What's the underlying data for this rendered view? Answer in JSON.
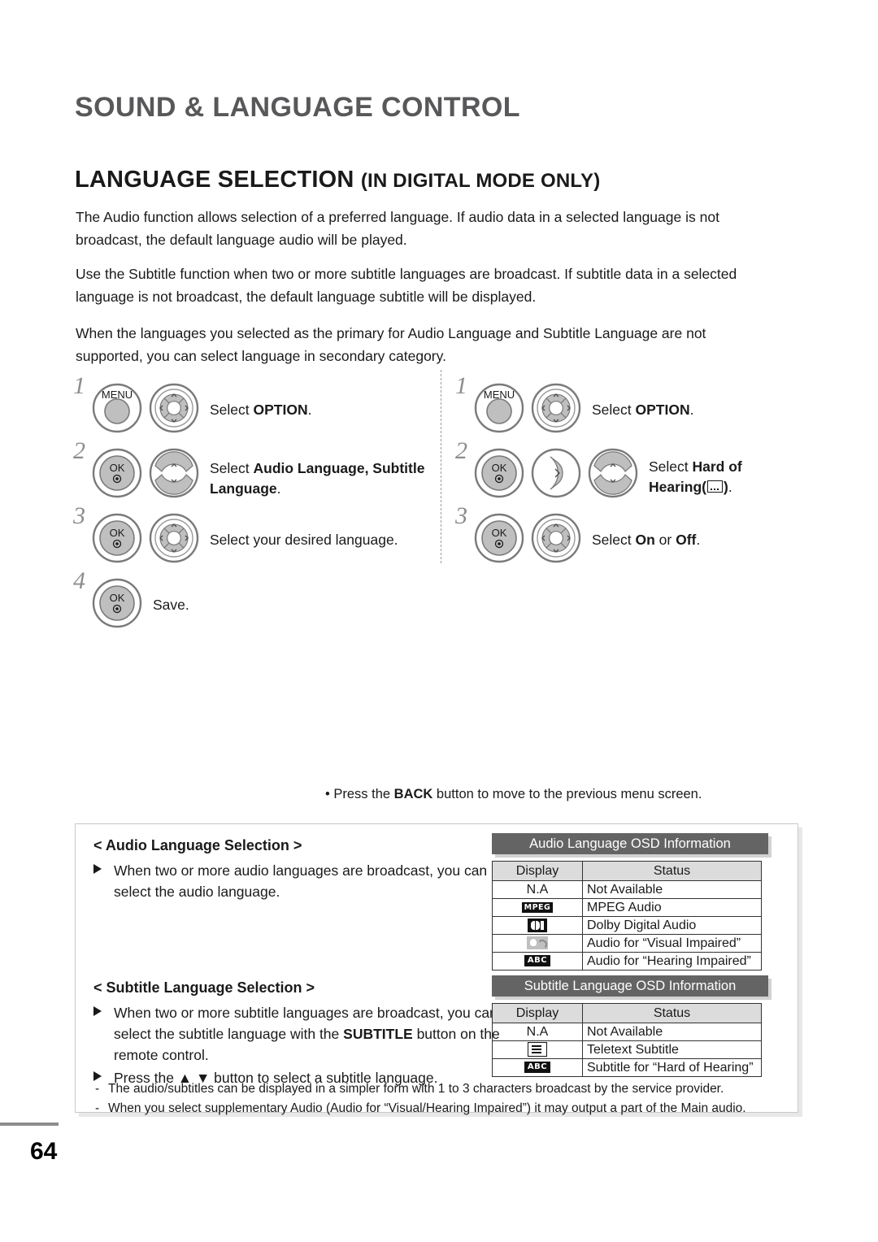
{
  "header": {
    "chapter_title": "SOUND & LANGUAGE CONTROL",
    "section_title": "LANGUAGE SELECTION",
    "section_subtitle": "(IN DIGITAL MODE ONLY)"
  },
  "intro": {
    "p1": "The Audio function allows selection of a preferred language. If audio data in a selected language is not broadcast, the default language audio will be played.",
    "p2": "Use the Subtitle function when two or more subtitle languages are broadcast. If subtitle data in a selected language is not broadcast, the default language subtitle will be displayed.",
    "p3": "When the languages you selected as the primary for Audio Language and Subtitle Language are not supported, you can select language in secondary category."
  },
  "steps_left": [
    {
      "number": "1",
      "buttons": [
        "MENU",
        "NAV4"
      ],
      "text_pre": "Select ",
      "text_bold": "OPTION",
      "text_post": "."
    },
    {
      "number": "2",
      "buttons": [
        "OK",
        "NAVUD"
      ],
      "text_pre": "Select ",
      "text_bold": "Audio Language, Subtitle Language",
      "text_post": "."
    },
    {
      "number": "3",
      "buttons": [
        "OK",
        "NAV4"
      ],
      "text_pre": "Select your desired language.",
      "text_bold": "",
      "text_post": ""
    },
    {
      "number": "4",
      "buttons": [
        "OK"
      ],
      "text_pre": "Save.",
      "text_bold": "",
      "text_post": ""
    }
  ],
  "steps_right": [
    {
      "number": "1",
      "buttons": [
        "MENU",
        "NAV4"
      ],
      "text_pre": "Select ",
      "text_bold": "OPTION",
      "text_post": "."
    },
    {
      "number": "2",
      "buttons": [
        "OK",
        "NAVR",
        "NAVUD"
      ],
      "text_pre": "Select ",
      "text_bold": "Hard of Hearing",
      "text_post": ""
    },
    {
      "number": "3",
      "buttons": [
        "OK",
        "NAV4"
      ],
      "text_pre": "Select ",
      "text_bold": "On",
      "text_mid": " or ",
      "text_bold2": "Off",
      "text_post": "."
    }
  ],
  "button_labels": {
    "menu": "MENU",
    "ok": "OK"
  },
  "tip": {
    "bullet": "•",
    "pre": "Press the ",
    "bold": "BACK",
    "post": " button to move to the previous menu screen."
  },
  "audio_section": {
    "heading": "< Audio Language Selection >",
    "bullet1": "When two or more audio languages are broadcast, you can select the audio language."
  },
  "subtitle_section": {
    "heading": "< Subtitle Language Selection >",
    "bullet1_pre": "When two or more subtitle languages are broadcast, you can select the subtitle language with the ",
    "bullet1_bold": "SUBTITLE",
    "bullet1_post": " button on the remote control.",
    "bullet2": "Press the ▲ ▼ button to select a subtitle language."
  },
  "notes": [
    "The audio/subtitles can be displayed in a simpler form with 1 to 3 characters broadcast by the service provider.",
    "When you select supplementary Audio (Audio for “Visual/Hearing Impaired”) it may output a part of the Main audio."
  ],
  "osd_audio": {
    "title": "Audio Language OSD Information",
    "columns": [
      "Display",
      "Status"
    ],
    "rows": [
      {
        "display_text": "N.A",
        "display_icon": "",
        "status": "Not Available"
      },
      {
        "display_text": "",
        "display_icon": "mpeg-icon",
        "status": "MPEG Audio"
      },
      {
        "display_text": "",
        "display_icon": "dolby-icon",
        "status": "Dolby Digital Audio"
      },
      {
        "display_text": "",
        "display_icon": "visual-impaired-icon",
        "status": "Audio for “Visual Impaired”"
      },
      {
        "display_text": "",
        "display_icon": "abc-icon",
        "status": "Audio for “Hearing Impaired”"
      }
    ]
  },
  "osd_subtitle": {
    "title": "Subtitle Language OSD Information",
    "columns": [
      "Display",
      "Status"
    ],
    "rows": [
      {
        "display_text": "N.A",
        "display_icon": "",
        "status": "Not Available"
      },
      {
        "display_text": "",
        "display_icon": "teletext-icon",
        "status": "Teletext Subtitle"
      },
      {
        "display_text": "",
        "display_icon": "abc-icon",
        "status": "Subtitle for “Hard of Hearing”"
      }
    ]
  },
  "glyph_labels": {
    "mpeg": "MPEG",
    "abc": "ABC"
  },
  "footer": {
    "page_number": "64"
  },
  "colors": {
    "chapter_gray": "#58585a",
    "osd_header_bg": "#646464",
    "table_header_bg": "#dcdcdc",
    "button_fill": "#bfbfbf"
  }
}
